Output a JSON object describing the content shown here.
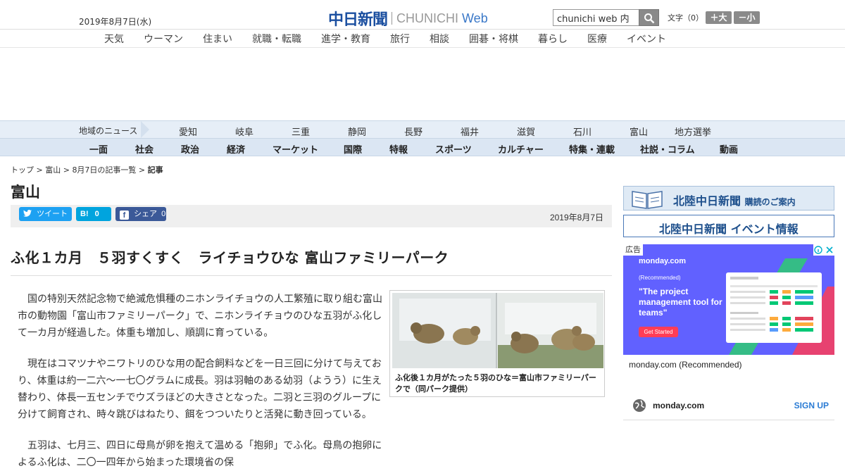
{
  "header": {
    "date": "2019年8月7日(水)",
    "logo_kanji": "中日新聞",
    "logo_latin": "CHUNICHI",
    "logo_web": "Web",
    "search_placeholder": "chunichi web 内",
    "textsize_label": "文字（0）",
    "larger_label": "＋大",
    "smaller_label": "－小"
  },
  "category_nav": [
    "天気",
    "ウーマン",
    "住まい",
    "就職・転職",
    "進学・教育",
    "旅行",
    "相談",
    "囲碁・将棋",
    "暮らし",
    "医療",
    "イベント"
  ],
  "region_nav": {
    "label": "地域のニュース",
    "items": [
      "愛知",
      "岐阜",
      "三重",
      "静岡",
      "長野",
      "福井",
      "滋賀",
      "石川",
      "富山",
      "地方選挙"
    ]
  },
  "section_nav": [
    "一面",
    "社会",
    "政治",
    "経済",
    "マーケット",
    "国際",
    "特報",
    "スポーツ",
    "カルチャー",
    "特集・連載",
    "社説・コラム",
    "動画"
  ],
  "breadcrumb": {
    "top": "トップ",
    "area": "富山",
    "list": "8月7日の記事一覧",
    "current": "記事",
    "sep": " > "
  },
  "area_title": "富山",
  "share": {
    "tweet": "ツイート",
    "hatena_count": "0",
    "facebook": "シェア",
    "facebook_count": "0",
    "date": "2019年8月7日"
  },
  "article": {
    "headline": "ふ化１カ月　５羽すくすく　ライチョウひな 富山ファミリーパーク",
    "paragraphs": [
      "　国の特別天然記念物で絶滅危惧種のニホンライチョウの人工繁殖に取り組む富山市の動物園「富山市ファミリーパーク」で、ニホンライチョウのひな五羽がふ化して一カ月が経過した。体重も増加し、順調に育っている。",
      "　現在はコマツナやニワトリのひな用の配合飼料などを一日三回に分けて与えており、体重は約一二六～一七〇グラムに成長。羽は羽軸のある幼羽（ようう）に生え替わり、体長一五センチでウズラほどの大きさとなった。二羽と三羽のグループに分けて飼育され、時々跳びはねたり、餌をつついたりと活発に動き回っている。",
      "　五羽は、七月三、四日に母鳥が卵を抱えて温める「抱卵」でふ化。母鳥の抱卵によるふ化は、二〇一四年から始まった環境省の保"
    ],
    "photo_caption": "ふ化後１カ月がたった５羽のひな＝富山市ファミリーパークで（同パーク提供）"
  },
  "sidebar": {
    "banner1_text": "北陸中日新聞",
    "banner1_sub": "購読のご案内",
    "banner2_text": "北陸中日新聞",
    "banner2_sub": "イベント情報",
    "ad": {
      "tag": "広告",
      "logo": "monday.com",
      "rating_label": "(Recommended)",
      "headline": "\"The project management tool for teams\"",
      "cta": "Get Started",
      "source": "monday.com (Recommended)",
      "brand": "monday.com",
      "signup": "SIGN UP"
    }
  },
  "colors": {
    "logo_blue": "#1b4fa0",
    "twitter": "#1da1f2",
    "hatena": "#00a4de",
    "facebook": "#3b5998",
    "ad_purple": "#6161ff"
  }
}
